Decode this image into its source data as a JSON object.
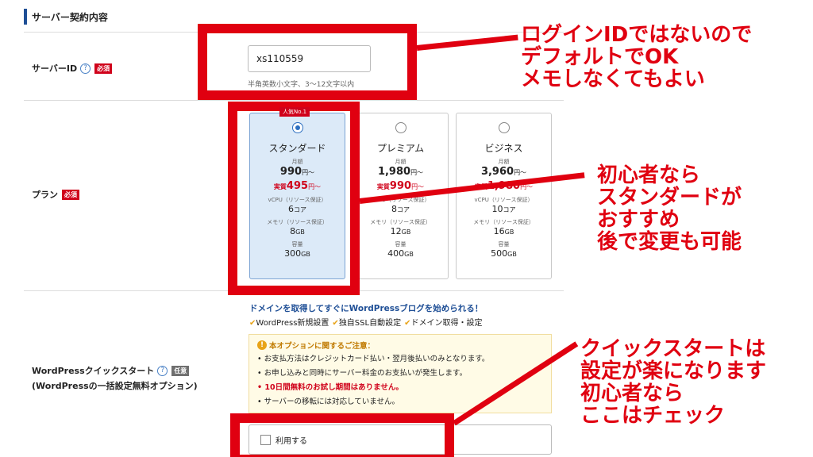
{
  "section": {
    "title": "サーバー契約内容"
  },
  "server_id": {
    "label": "サーバーID",
    "help": "?",
    "required_badge": "必須",
    "value": "xs110559",
    "hint": "半角英数小文字、3〜12文字以内"
  },
  "plan": {
    "label": "プラン",
    "required_badge": "必須",
    "popular_badge": "人気No.1",
    "monthly_label": "月額",
    "real_label": "実質",
    "cpu_label": "vCPU（リソース保証）",
    "memory_label": "メモリ（リソース保証）",
    "storage_label": "容量",
    "options": [
      {
        "name": "スタンダード",
        "price": "990",
        "price_unit": "円〜",
        "real_price": "495",
        "real_unit": "円〜",
        "cpu": "6",
        "cpu_unit": "コア",
        "memory": "8",
        "memory_unit": "GB",
        "storage": "300",
        "storage_unit": "GB",
        "selected": true
      },
      {
        "name": "プレミアム",
        "price": "1,980",
        "price_unit": "円〜",
        "real_price": "990",
        "real_unit": "円〜",
        "cpu": "8",
        "cpu_unit": "コア",
        "memory": "12",
        "memory_unit": "GB",
        "storage": "400",
        "storage_unit": "GB",
        "selected": false
      },
      {
        "name": "ビジネス",
        "price": "3,960",
        "price_unit": "円〜",
        "real_price": "1,980",
        "real_unit": "円〜",
        "cpu": "10",
        "cpu_unit": "コア",
        "memory": "16",
        "memory_unit": "GB",
        "storage": "500",
        "storage_unit": "GB",
        "selected": false
      }
    ]
  },
  "wp_quick": {
    "label": "WordPressクイックスタート",
    "help": "?",
    "optional_badge": "任意",
    "sublabel": "(WordPressの一括設定無料オプション)",
    "promo": "ドメインを取得してすぐにWordPressブログを始められる！",
    "features": [
      "WordPress新規設置",
      "独自SSL自動設定",
      "ドメイン取得・設定"
    ],
    "notice_title": "本オプションに関するご注意：",
    "notices": [
      "お支払方法はクレジットカード払い・翌月後払いのみとなります。",
      "お申し込みと同時にサーバー料金のお支払いが発生します。",
      "10日間無料のお試し期間はありません。",
      "サーバーの移転には対応していません。"
    ],
    "use_label": "利用する",
    "use_checked": false
  },
  "annotations": {
    "login": "ログインIDではないので\nデフォルトでOK\nメモしなくてもよい",
    "plan": "初心者なら\nスタンダードが\nおすすめ\n後で変更も可能",
    "quick": "クイックスタートは\n設定が楽になります\n初心者なら\nここはチェック",
    "color": "#e00010"
  },
  "colors": {
    "accent": "#1f4f96",
    "required": "#d0021b",
    "selected_plan_bg": "#dceaf8"
  }
}
